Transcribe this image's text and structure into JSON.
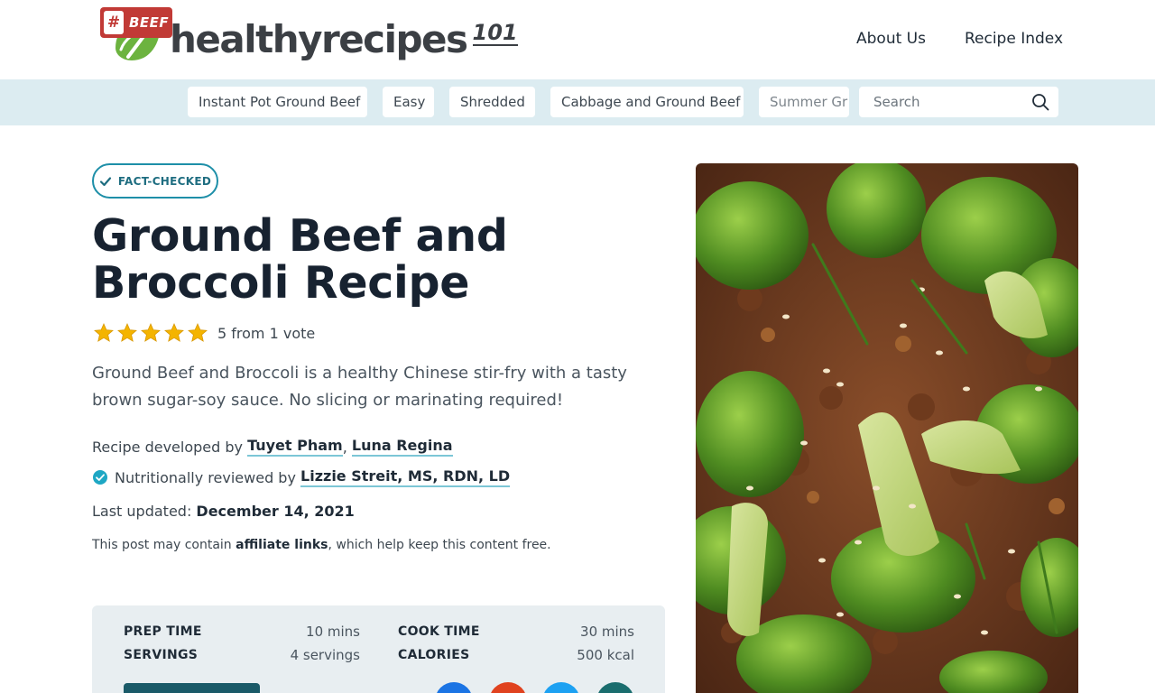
{
  "header": {
    "logo_text": "healthyrecipes",
    "logo_suffix": "101",
    "nav": [
      {
        "label": "About Us"
      },
      {
        "label": "Recipe Index"
      }
    ]
  },
  "tagbar": {
    "badge_hash": "#",
    "badge_word": "BEEF",
    "tags": [
      "Instant Pot Ground Beef",
      "Easy",
      "Shredded",
      "Cabbage and Ground Beef",
      "Summer Gr"
    ],
    "search_placeholder": "Search"
  },
  "article": {
    "fact_checked": "FACT-CHECKED",
    "title": "Ground Beef and Broccoli Recipe",
    "rating": {
      "stars": 5,
      "text": "5 from 1 vote"
    },
    "description": "Ground Beef and Broccoli is a healthy Chinese stir-fry with a tasty brown sugar-soy sauce. No slicing or marinating required!",
    "developed_prefix": "Recipe developed by ",
    "authors": [
      "Tuyet Pham",
      "Luna Regina"
    ],
    "author_separator": ", ",
    "reviewed_prefix": "Nutritionally reviewed by ",
    "reviewer": "Lizzie Streit, MS, RDN, LD",
    "updated_prefix": "Last updated: ",
    "updated_date": "December 14, 2021",
    "affiliate_pre": "This post may contain ",
    "affiliate_link": "affiliate links",
    "affiliate_post": ", which help keep this content free."
  },
  "recipe_card": {
    "prep_label": "PREP TIME",
    "prep_value": "10 mins",
    "cook_label": "COOK TIME",
    "cook_value": "30 mins",
    "servings_label": "SERVINGS",
    "servings_value": "4 servings",
    "calories_label": "CALORIES",
    "calories_value": "500 kcal"
  },
  "colors": {
    "accent_teal": "#1e8fa8",
    "tag_bar_bg": "#dcecf1",
    "beef_badge": "#c13a36",
    "star": "#f4b400",
    "logo_green": "#6cb33f",
    "card_bg": "#e8eef1"
  },
  "icons": {
    "search": "search-icon",
    "check": "check-icon",
    "verified": "verified-badge-icon",
    "star": "star-icon"
  }
}
